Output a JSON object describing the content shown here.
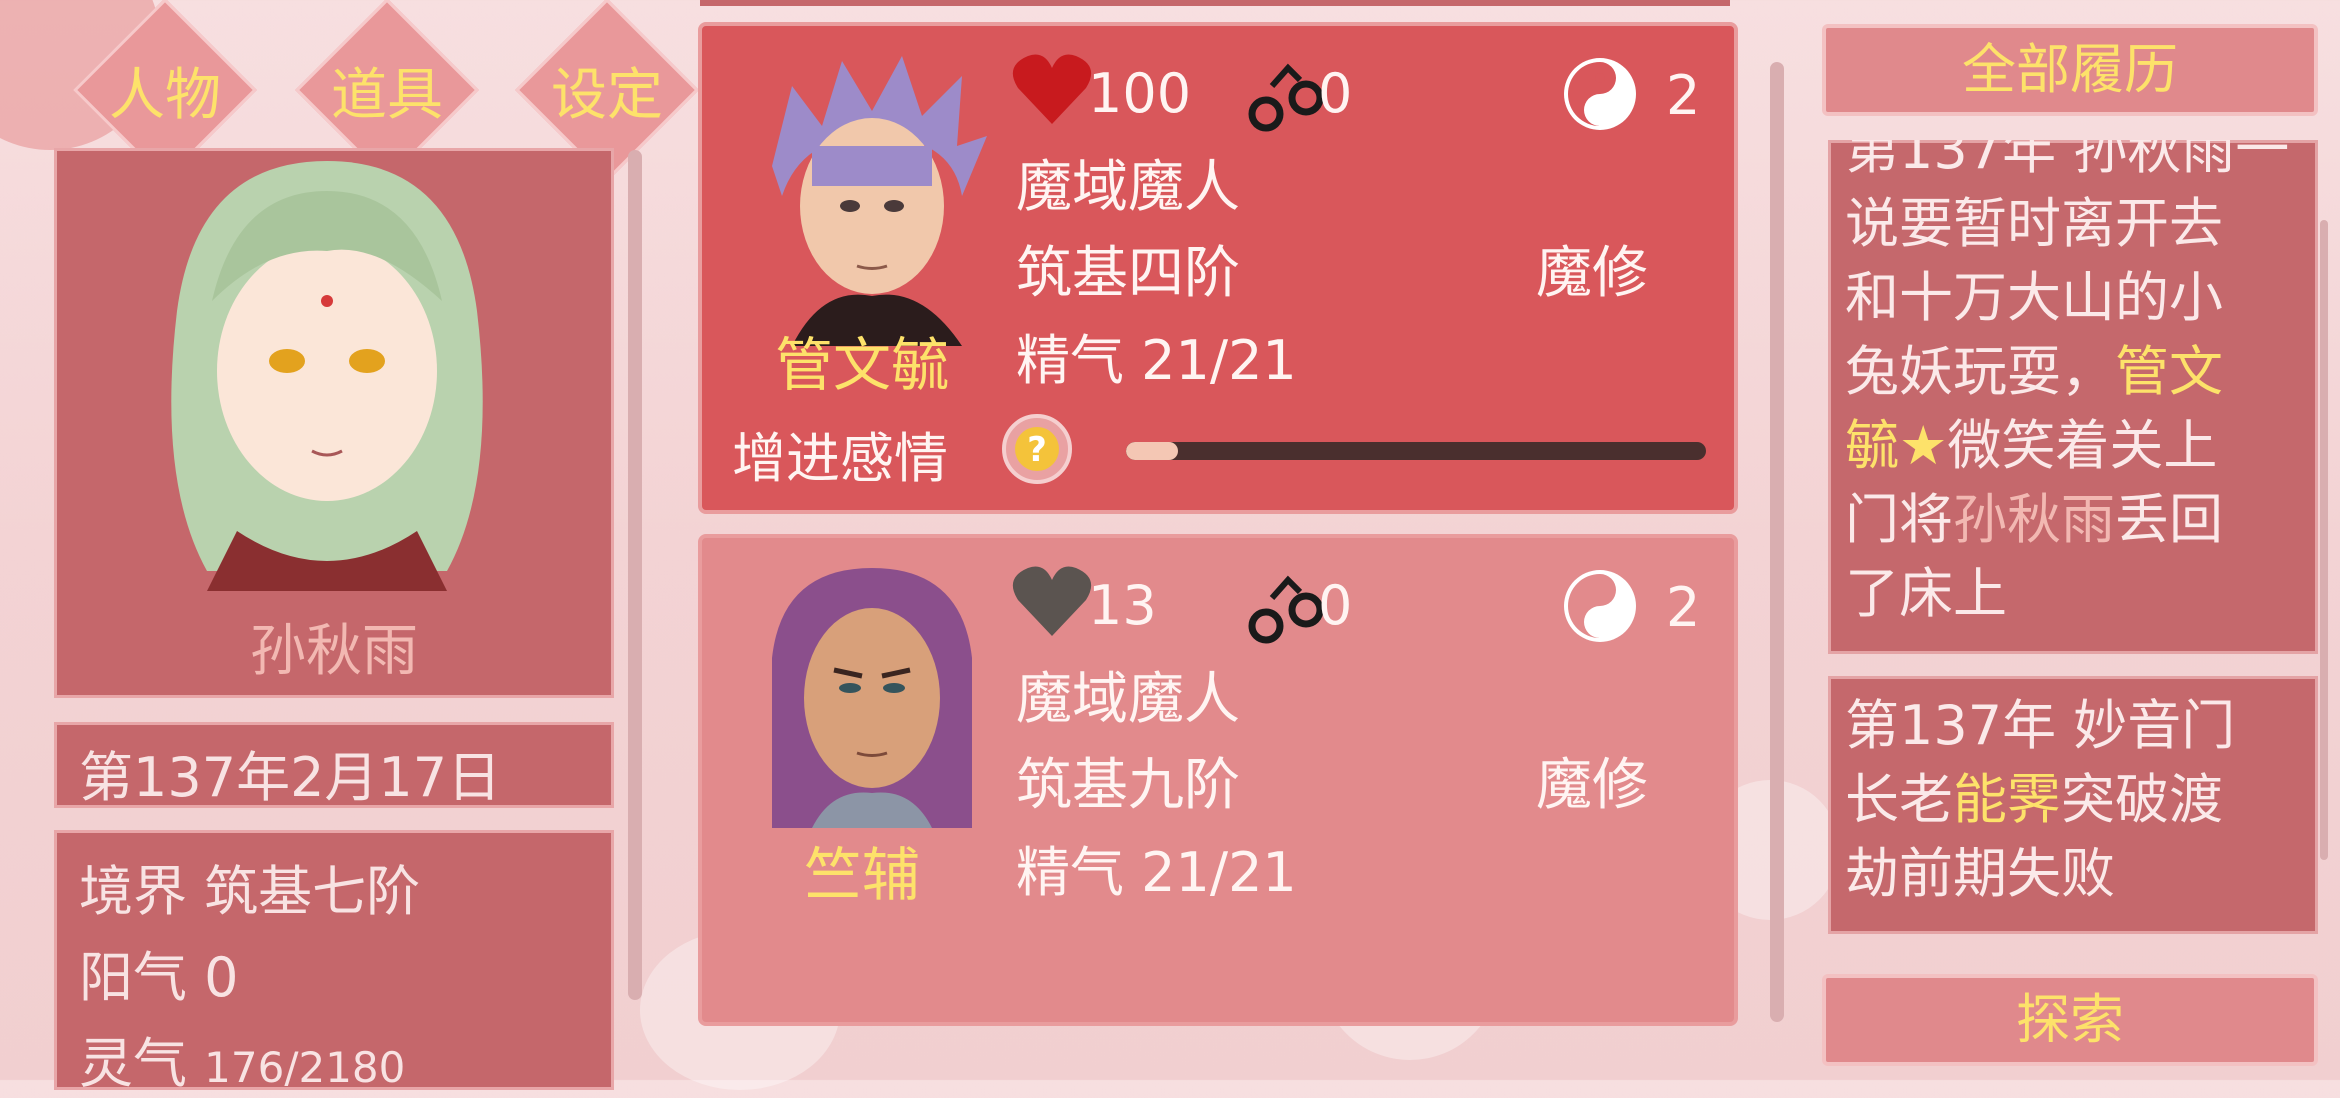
{
  "tabs": {
    "people": "人物",
    "items": "道具",
    "settings": "设定"
  },
  "player": {
    "name": "孙秋雨",
    "date": "第137年2月17日",
    "realm_label": "境界",
    "realm_value": "筑基七阶",
    "yang_label": "阳气",
    "yang_value": "0",
    "spirit_label": "灵气",
    "spirit_value": "176/2180"
  },
  "characters": [
    {
      "name": "管文毓",
      "affection": "100",
      "bonds": "0",
      "yinyang": "2",
      "race": "魔域魔人",
      "realm": "筑基四阶",
      "sect": "魔修",
      "essence": "精气 21/21",
      "improve_label": "增进感情",
      "progress": 0.09
    },
    {
      "name": "竺辅",
      "affection": "13",
      "bonds": "0",
      "yinyang": "2",
      "race": "魔域魔人",
      "realm": "筑基九阶",
      "sect": "魔修",
      "essence": "精气 21/21"
    }
  ],
  "history": {
    "title": "全部履历",
    "entry1": {
      "line0": "第137年 孙秋雨一",
      "line1": "说要暂时离开去",
      "line2": "和十万大山的小",
      "line3a": "兔妖玩耍，",
      "line3b": "管文",
      "line4a": "毓★",
      "line4b": "微笑着关上",
      "line5a": "门将",
      "line5b": "孙秋雨",
      "line5c": "丢回",
      "line6": "了床上"
    },
    "entry2": {
      "line1": "第137年 妙音门",
      "line2a": "长老",
      "line2b": "能霁",
      "line2c": "突破渡",
      "line3": "劫前期失败"
    },
    "explore": "探索"
  },
  "colors": {
    "accent_yellow": "#fde26a",
    "heart_red": "#c81a1e",
    "heart_gray": "#5b5450"
  },
  "icons": [
    "heart-icon",
    "handcuffs-icon",
    "yinyang-icon",
    "question-icon"
  ]
}
